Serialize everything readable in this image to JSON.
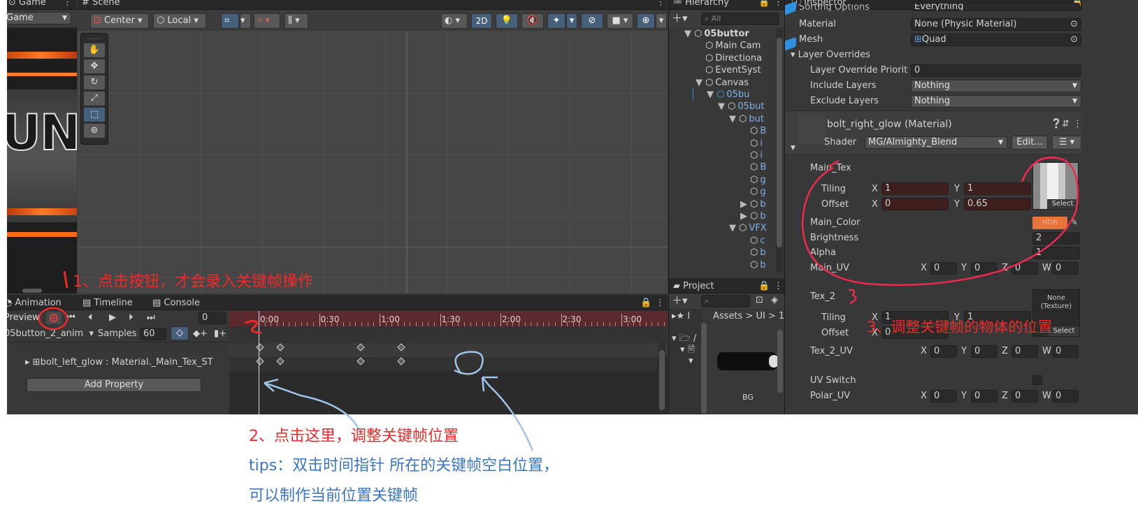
{
  "tabs": {
    "game": "Game",
    "scene": "Scene",
    "hierarchy": "Hierarchy",
    "inspector": "Inspector",
    "project": "Project",
    "animation": "Animation",
    "timeline": "Timeline",
    "console": "Console"
  },
  "game": {
    "display": "Game",
    "overlay_text": "UNI"
  },
  "scene_toolbar": {
    "pivot": "Center",
    "space": "Local",
    "mode_2d": "2D"
  },
  "hierarchy": {
    "search_placeholder": "All",
    "items": [
      {
        "label": "05buttor",
        "indent": 0,
        "arrow": "▼",
        "bold": true
      },
      {
        "label": "Main Cam",
        "indent": 1,
        "arrow": ""
      },
      {
        "label": "Directiona",
        "indent": 1,
        "arrow": ""
      },
      {
        "label": "EventSyst",
        "indent": 1,
        "arrow": ""
      },
      {
        "label": "Canvas",
        "indent": 1,
        "arrow": "▼"
      },
      {
        "label": "05bu",
        "indent": 2,
        "arrow": "▼",
        "blue": true
      },
      {
        "label": "05but",
        "indent": 3,
        "arrow": "▼",
        "blue": true
      },
      {
        "label": "but",
        "indent": 4,
        "arrow": "▼",
        "blue": true
      },
      {
        "label": "B",
        "indent": 5,
        "arrow": "",
        "blue": true
      },
      {
        "label": "i",
        "indent": 5,
        "arrow": "",
        "blue": true
      },
      {
        "label": "i",
        "indent": 5,
        "arrow": "",
        "blue": true
      },
      {
        "label": "B",
        "indent": 5,
        "arrow": "",
        "blue": true
      },
      {
        "label": "g",
        "indent": 5,
        "arrow": "",
        "blue": true
      },
      {
        "label": "g",
        "indent": 5,
        "arrow": "",
        "blue": true
      },
      {
        "label": "b",
        "indent": 5,
        "arrow": "▶",
        "blue": true
      },
      {
        "label": "b",
        "indent": 5,
        "arrow": "▶",
        "blue": true
      },
      {
        "label": "VFX",
        "indent": 4,
        "arrow": "▼",
        "blue": true
      },
      {
        "label": "c",
        "indent": 5,
        "arrow": "",
        "blue": true
      },
      {
        "label": "b",
        "indent": 5,
        "arrow": "",
        "blue": true
      },
      {
        "label": "b",
        "indent": 5,
        "arrow": "",
        "blue": true
      }
    ]
  },
  "project": {
    "breadcrumb": [
      "Assets",
      "UI",
      "1"
    ],
    "asset_label": "BG"
  },
  "animation": {
    "preview": "Preview",
    "frame": "0",
    "clip": "05button_2_anim",
    "samples_label": "Samples",
    "samples": "60",
    "property": "bolt_left_glow : Material._Main_Tex_ST",
    "add_property": "Add Property",
    "ruler": [
      "0:00",
      "0:30",
      "1:00",
      "1:30",
      "2:00",
      "2:30",
      "3:00"
    ],
    "keyframe_times": [
      0,
      10,
      50,
      70
    ]
  },
  "inspector": {
    "top_cut": "Sorting Options",
    "top_cut_value": "Everything",
    "material_label": "Material",
    "material_value": "None (Physic Material)",
    "mesh_label": "Mesh",
    "mesh_value": "Quad",
    "layer_overrides": "Layer Overrides",
    "priority_label": "Layer Override Priority",
    "priority_value": "0",
    "include_label": "Include Layers",
    "include_value": "Nothing",
    "exclude_label": "Exclude Layers",
    "exclude_value": "Nothing",
    "material_name": "bolt_right_glow (Material)",
    "shader_label": "Shader",
    "shader_value": "MG/Almighty_Blend",
    "edit_button": "Edit...",
    "main_tex": "Main_Tex",
    "tiling": "Tiling",
    "offset": "Offset",
    "x": "X",
    "y": "Y",
    "z": "Z",
    "w": "W",
    "main_tiling_x": "1",
    "main_tiling_y": "1",
    "main_offset_x": "0",
    "main_offset_y": "0.65",
    "select": "Select",
    "main_color": "Main_Color",
    "hdr": "HDR",
    "brightness_label": "Brightness",
    "brightness_value": "2",
    "alpha_label": "Alpha",
    "alpha_value": "1",
    "main_uv": "Main_UV",
    "zero": "0",
    "one": "1",
    "tex2": "Tex_2",
    "none_texture": "None (Texture)",
    "tex2_uv": "Tex_2_UV",
    "uv_switch": "UV Switch",
    "polar_uv": "Polar_UV"
  },
  "annotations": {
    "step1": "1、点击按钮，才会录入关键帧操作",
    "step2": "2、点击这里，调整关键帧位置",
    "tips1": "tips：双击时间指针 所在的关键帧空白位置，",
    "tips2": "可以制作当前位置关键帧",
    "step3": "3、调整关键帧的物体的位置"
  },
  "colors": {
    "record": "#e04040",
    "hdr": "#e8743b",
    "annotation_red": "#ee2a2a",
    "annotation_blue": "#3a76c4",
    "timeline_header": "#5a2a2e"
  }
}
